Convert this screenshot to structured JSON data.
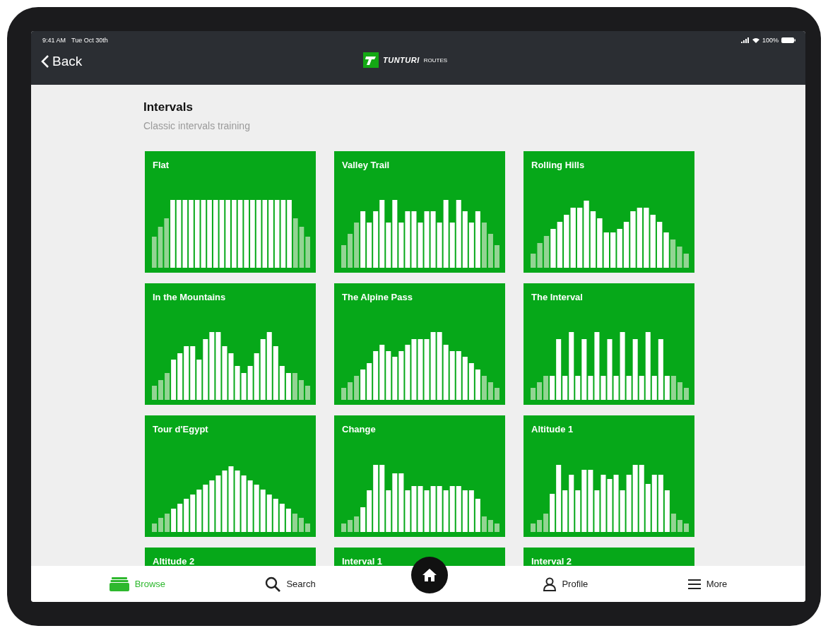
{
  "status_bar": {
    "time": "9:41 AM",
    "date": "Tue Oct 30th",
    "battery": "100%"
  },
  "nav_bar": {
    "back": "Back",
    "logo_brand": "TUNTURI",
    "logo_product": "ROUTES"
  },
  "section": {
    "title": "Intervals",
    "subtitle": "Classic intervals training"
  },
  "routes": [
    {
      "name": "Flat"
    },
    {
      "name": "Valley Trail"
    },
    {
      "name": "Rolling Hills"
    },
    {
      "name": "In the Mountains"
    },
    {
      "name": "The Alpine Pass"
    },
    {
      "name": "The Interval"
    },
    {
      "name": "Tour d'Egypt"
    },
    {
      "name": "Change"
    },
    {
      "name": "Altitude 1"
    },
    {
      "name": "Altitude 2"
    },
    {
      "name": "Interval 1"
    },
    {
      "name": "Interval 2"
    }
  ],
  "tab_bar": [
    {
      "kind": "browse",
      "label": "Browse",
      "selected": true
    },
    {
      "kind": "search",
      "label": "Search",
      "selected": false
    },
    {
      "kind": "home",
      "selected": false
    },
    {
      "kind": "profile",
      "label": "Profile",
      "selected": false
    },
    {
      "kind": "more",
      "label": "More",
      "selected": false
    }
  ]
}
